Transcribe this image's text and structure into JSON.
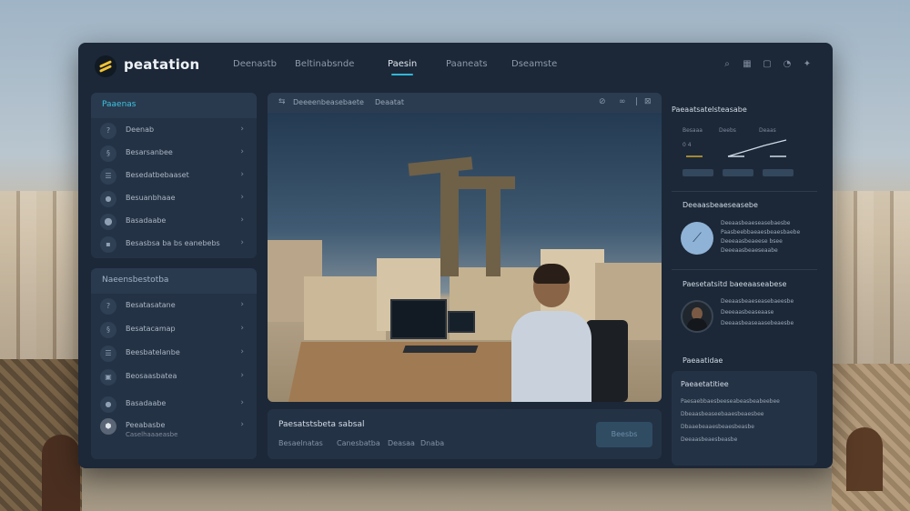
{
  "app": {
    "brand": "peatation",
    "nav": [
      "Deenastb",
      "Beltinabsnde",
      "Paesin",
      "Paaneats",
      "Dseamste"
    ],
    "active_nav": 2,
    "top_icons": [
      "search-icon",
      "grid-icon",
      "chat-icon",
      "bell-icon",
      "settings-icon"
    ]
  },
  "sidebar_top": {
    "title": "Paaenas",
    "items": [
      {
        "label": "Deenab",
        "icon": "?"
      },
      {
        "label": "Besarsanbee",
        "icon": "§"
      },
      {
        "label": "Besedatbebaaset",
        "icon": "☰"
      },
      {
        "label": "Besuanbhaae",
        "icon": "●"
      },
      {
        "label": "Basadaabe",
        "icon": "⬤"
      },
      {
        "label": "Besasbsa ba bs eanebebs",
        "icon": "▪"
      }
    ]
  },
  "sidebar_bottom": {
    "title": "Naeensbestotba",
    "items": [
      {
        "label": "Besatasatane",
        "icon": "?"
      },
      {
        "label": "Besatacamap",
        "icon": "§"
      },
      {
        "label": "Beesbatelanbe",
        "icon": "☰"
      },
      {
        "label": "Beosaasbatea",
        "icon": "▣"
      },
      {
        "label": "Basadaabe",
        "icon": "●"
      },
      {
        "label": "Peeabasbe",
        "sub": "Caselhaaaeasbe",
        "icon": "⬢"
      }
    ]
  },
  "viewer": {
    "breadcrumb_1": "Deeeenbeasebaete",
    "breadcrumb_2": "Deaatat",
    "footer_title": "Paesatstsbeta sabsal",
    "footer_tabs": [
      "Besaelnatas",
      "Canesbatba",
      "Deasaa",
      "Dnaba"
    ],
    "footer_button": "Beesbs"
  },
  "right": {
    "stats_title": "Paeaatsatelsteasabe",
    "stats_cols": [
      "Besaaa",
      "Deebs",
      "Deaas"
    ],
    "stat_value": "0 4",
    "section2_title": "Deeaasbeaeseasebe",
    "section2_lines": [
      "Deeaasbeaeseasebaesbe",
      "Paasbeebbaeaesbeaesbaebe",
      "Deeeaasbeaeese bsee",
      "Deeeaasbeaeseaabe"
    ],
    "section3_title": "Paesetatsitd  baeeaaseabese",
    "section3_lines": [
      "Deeaasbeaeseasebaeesbe",
      "Deeeaasbeaseaase",
      "Deeaasbeaseaasebeaesbe"
    ],
    "section4_title": "Paeaatidae",
    "panel_title": "Paeaetatitiee",
    "panel_lines": [
      "Paesaebbaesbeeseabeasbeabeebee",
      "Dbeaasbeaseebaaesbeaesbee",
      "Dbaaebeaaesbeaesbeasbe",
      "Deeaasbeaesbeasbe"
    ]
  },
  "colors": {
    "accent": "#31b7d6",
    "panel": "#243245",
    "window": "#1c2838",
    "brand_mark": "#f2c230"
  }
}
